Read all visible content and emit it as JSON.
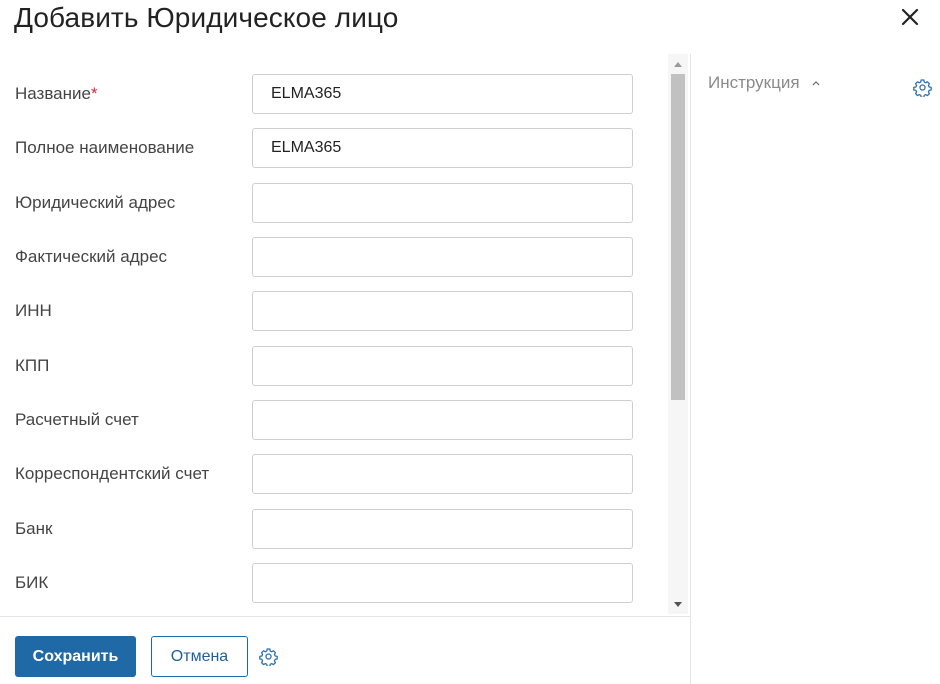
{
  "dialog": {
    "title": "Добавить Юридическое лицо",
    "close_icon": "close-icon"
  },
  "form": {
    "fields": [
      {
        "label": "Название",
        "required_mark": "*",
        "value": "ELMA365"
      },
      {
        "label": "Полное наименование",
        "value": "ELMA365"
      },
      {
        "label": "Юридический адрес",
        "value": ""
      },
      {
        "label": "Фактический адрес",
        "value": ""
      },
      {
        "label": "ИНН",
        "value": ""
      },
      {
        "label": "КПП",
        "value": ""
      },
      {
        "label": "Расчетный счет",
        "value": ""
      },
      {
        "label": "Корреспондентский счет",
        "value": ""
      },
      {
        "label": "Банк",
        "value": ""
      },
      {
        "label": "БИК",
        "value": ""
      }
    ]
  },
  "footer": {
    "save_label": "Сохранить",
    "cancel_label": "Отмена",
    "settings_icon": "gear-icon"
  },
  "side_panel": {
    "instruction_label": "Инструкция",
    "toggle_icon": "chevron-up-icon",
    "settings_icon": "gear-icon"
  },
  "colors": {
    "primary": "#1f6aa6",
    "required": "#e0243c",
    "icon_accent": "#2a6fb0"
  }
}
